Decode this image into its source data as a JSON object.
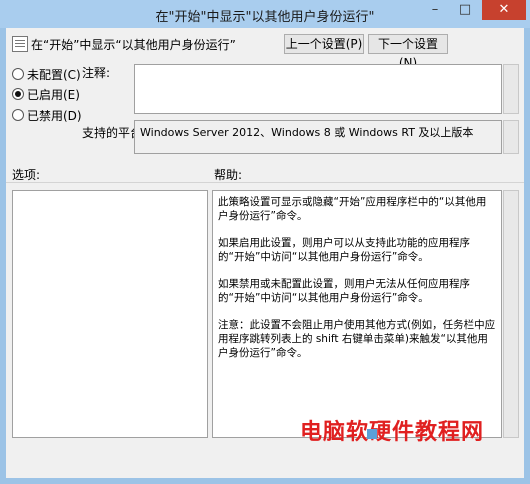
{
  "window": {
    "title": "在\"开始\"中显示\"以其他用户身份运行\"",
    "min": "–",
    "max": "□",
    "close": "✕"
  },
  "header": {
    "title": "在“开始”中显示“以其他用户身份运行”",
    "icon": "policy-icon"
  },
  "nav": {
    "prev": "上一个设置(P)",
    "next": "下一个设置(N)"
  },
  "radios": [
    {
      "label": "未配置(C)",
      "selected": false
    },
    {
      "label": "已启用(E)",
      "selected": true
    },
    {
      "label": "已禁用(D)",
      "selected": false
    }
  ],
  "comment": {
    "label": "注释:"
  },
  "platform": {
    "label": "支持的平台:",
    "value": "Windows Server 2012、Windows 8 或 Windows RT 及以上版本"
  },
  "options": {
    "label": "选项:"
  },
  "help": {
    "label": "帮助:",
    "paragraphs": [
      "此策略设置可显示或隐藏“开始”应用程序栏中的“以其他用户身份运行”命令。",
      "如果启用此设置，则用户可以从支持此功能的应用程序的“开始”中访问“以其他用户身份运行”命令。",
      "如果禁用或未配置此设置，则用户无法从任何应用程序的“开始”中访问“以其他用户身份运行”命令。",
      "注意：此设置不会阻止用户使用其他方式(例如，任务栏中应用程序跳转列表上的 shift 右键单击菜单)来触发“以其他用户身份运行”命令。"
    ]
  },
  "watermark": {
    "text": "电脑软硬件教程网"
  }
}
